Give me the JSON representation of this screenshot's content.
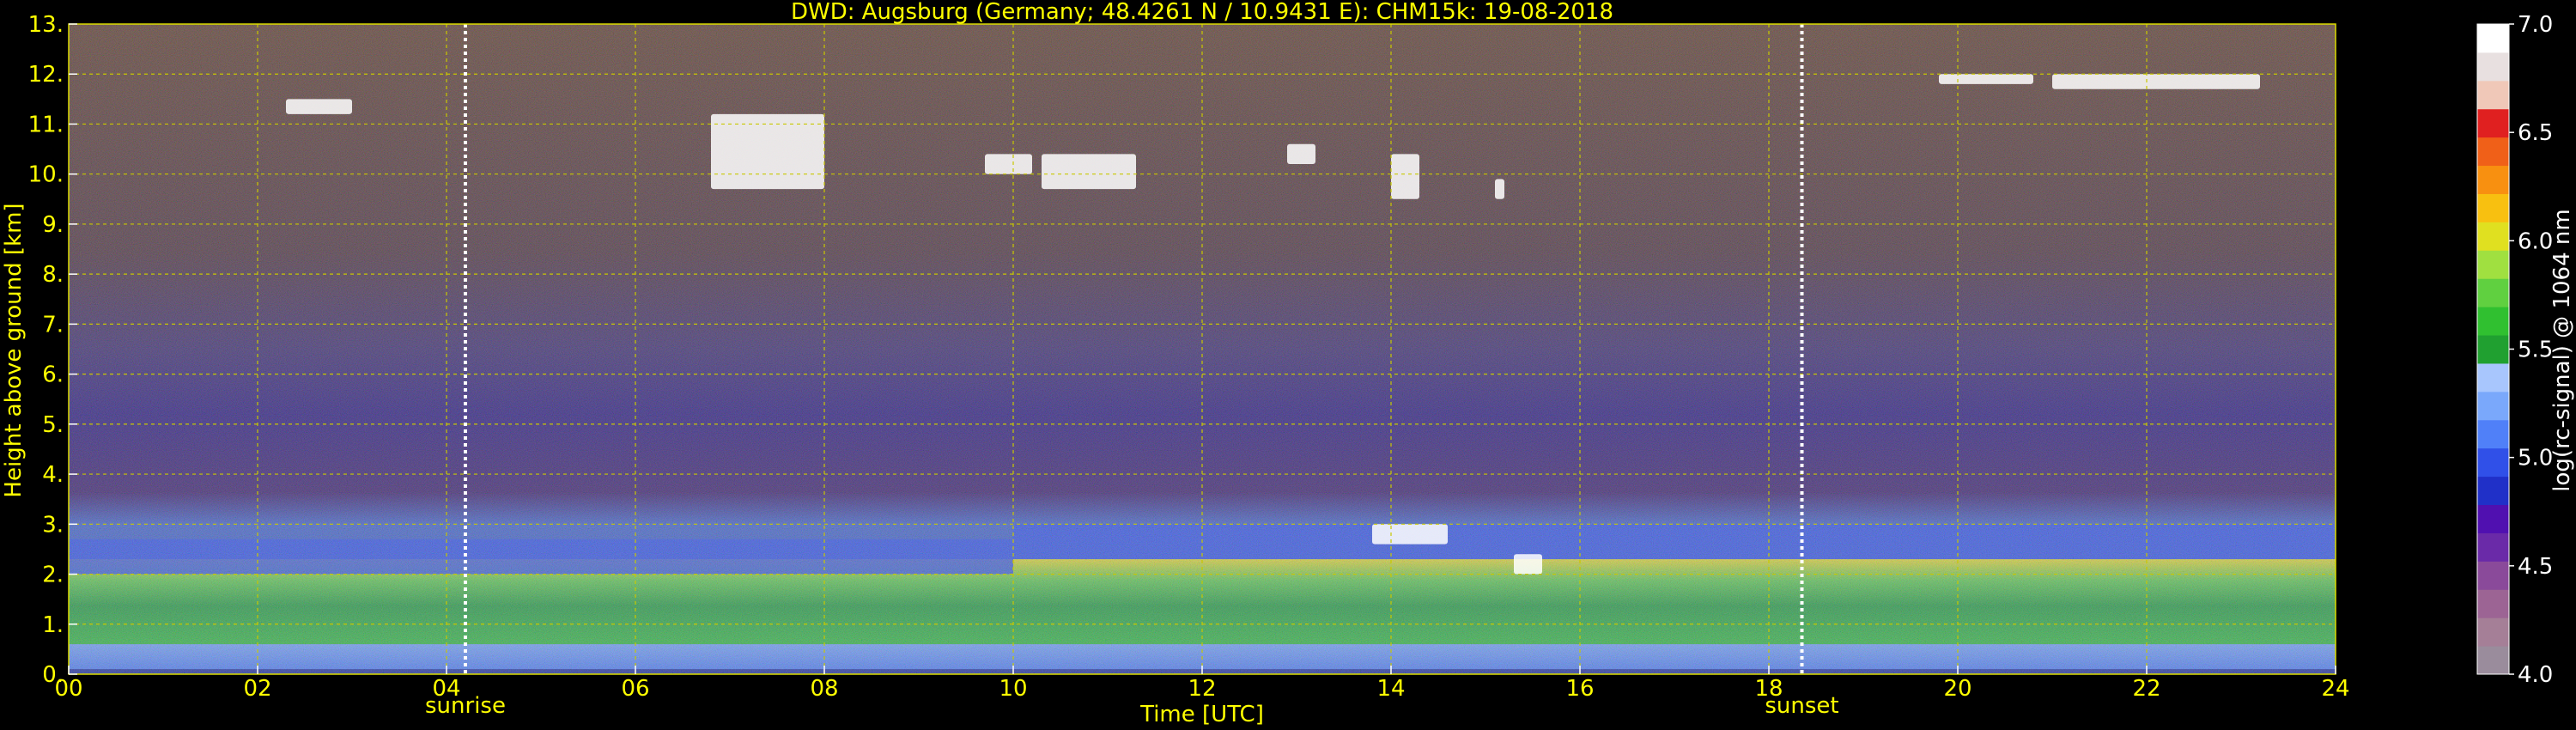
{
  "chart_data": {
    "type": "heatmap",
    "title": "DWD: Augsburg (Germany; 48.4261 N / 10.9431 E):    CHM15k: 19-08-2018",
    "xlabel": "Time [UTC]",
    "ylabel": "Height above ground [km]",
    "xlim": [
      0,
      24
    ],
    "ylim": [
      0,
      13
    ],
    "x_ticks": [
      "00",
      "02",
      "04",
      "06",
      "08",
      "10",
      "12",
      "14",
      "16",
      "18",
      "20",
      "22",
      "24"
    ],
    "y_ticks": [
      "0.",
      "1.",
      "2.",
      "3.",
      "4.",
      "5.",
      "6.",
      "7.",
      "8.",
      "9.",
      "10.",
      "11.",
      "12.",
      "13."
    ],
    "grid": true,
    "vertical_markers": [
      {
        "label": "sunrise",
        "x": 4.2
      },
      {
        "label": "sunset",
        "x": 18.35
      }
    ],
    "colorbar": {
      "label": "log(rc-signal) @ 1064 nm",
      "range": [
        4.0,
        7.0
      ],
      "ticks": [
        "4.0",
        "4.5",
        "5.0",
        "5.5",
        "6.0",
        "6.5",
        "7.0"
      ],
      "colors": [
        "#9a8c9c",
        "#a57f97",
        "#9c6494",
        "#8a4a9a",
        "#6a2aa8",
        "#5010b0",
        "#2030c8",
        "#3050e8",
        "#5080f8",
        "#7aa8fb",
        "#a8c6fd",
        "#20a030",
        "#30c030",
        "#60d040",
        "#a0e040",
        "#e0e020",
        "#f8c010",
        "#f89010",
        "#f06018",
        "#e02020",
        "#f0c8b8",
        "#e8e0e0",
        "#ffffff"
      ]
    },
    "layers": [
      {
        "name": "near-surface low signal",
        "x": [
          0,
          24
        ],
        "height_km": [
          0.1,
          0.6
        ],
        "log_signal": 4.8
      },
      {
        "name": "boundary layer",
        "x": [
          0,
          24
        ],
        "height_km": [
          0.6,
          2.3
        ],
        "log_signal": [
          5.2,
          5.8
        ]
      },
      {
        "name": "residual layer top",
        "x": [
          0,
          10
        ],
        "height_km": [
          2.0,
          2.7
        ],
        "log_signal": 5.0
      },
      {
        "name": "aerosol layer",
        "x": [
          10,
          24
        ],
        "height_km": [
          2.3,
          3.0
        ],
        "log_signal": 4.9
      },
      {
        "name": "free troposphere",
        "x": [
          0,
          24
        ],
        "height_km": [
          3.0,
          6.5
        ],
        "log_signal": 4.4
      },
      {
        "name": "noise region",
        "x": [
          0,
          24
        ],
        "height_km": [
          6.5,
          13.0
        ],
        "log_signal": 4.6
      }
    ],
    "clouds": [
      {
        "x": [
          2.3,
          3.0
        ],
        "height_km": [
          11.2,
          11.5
        ]
      },
      {
        "x": [
          6.8,
          8.0
        ],
        "height_km": [
          9.7,
          11.2
        ]
      },
      {
        "x": [
          9.7,
          10.2
        ],
        "height_km": [
          10.0,
          10.4
        ]
      },
      {
        "x": [
          10.3,
          11.3
        ],
        "height_km": [
          9.7,
          10.4
        ]
      },
      {
        "x": [
          12.9,
          13.2
        ],
        "height_km": [
          10.2,
          10.6
        ]
      },
      {
        "x": [
          14.0,
          14.3
        ],
        "height_km": [
          9.5,
          10.4
        ]
      },
      {
        "x": [
          15.1,
          15.2
        ],
        "height_km": [
          9.5,
          9.9
        ]
      },
      {
        "x": [
          19.8,
          20.8
        ],
        "height_km": [
          11.8,
          12.0
        ]
      },
      {
        "x": [
          21.0,
          23.2
        ],
        "height_km": [
          11.7,
          12.0
        ]
      },
      {
        "x": [
          13.8,
          14.6
        ],
        "height_km": [
          2.6,
          3.0
        ]
      },
      {
        "x": [
          15.3,
          15.6
        ],
        "height_km": [
          2.0,
          2.4
        ]
      }
    ]
  }
}
